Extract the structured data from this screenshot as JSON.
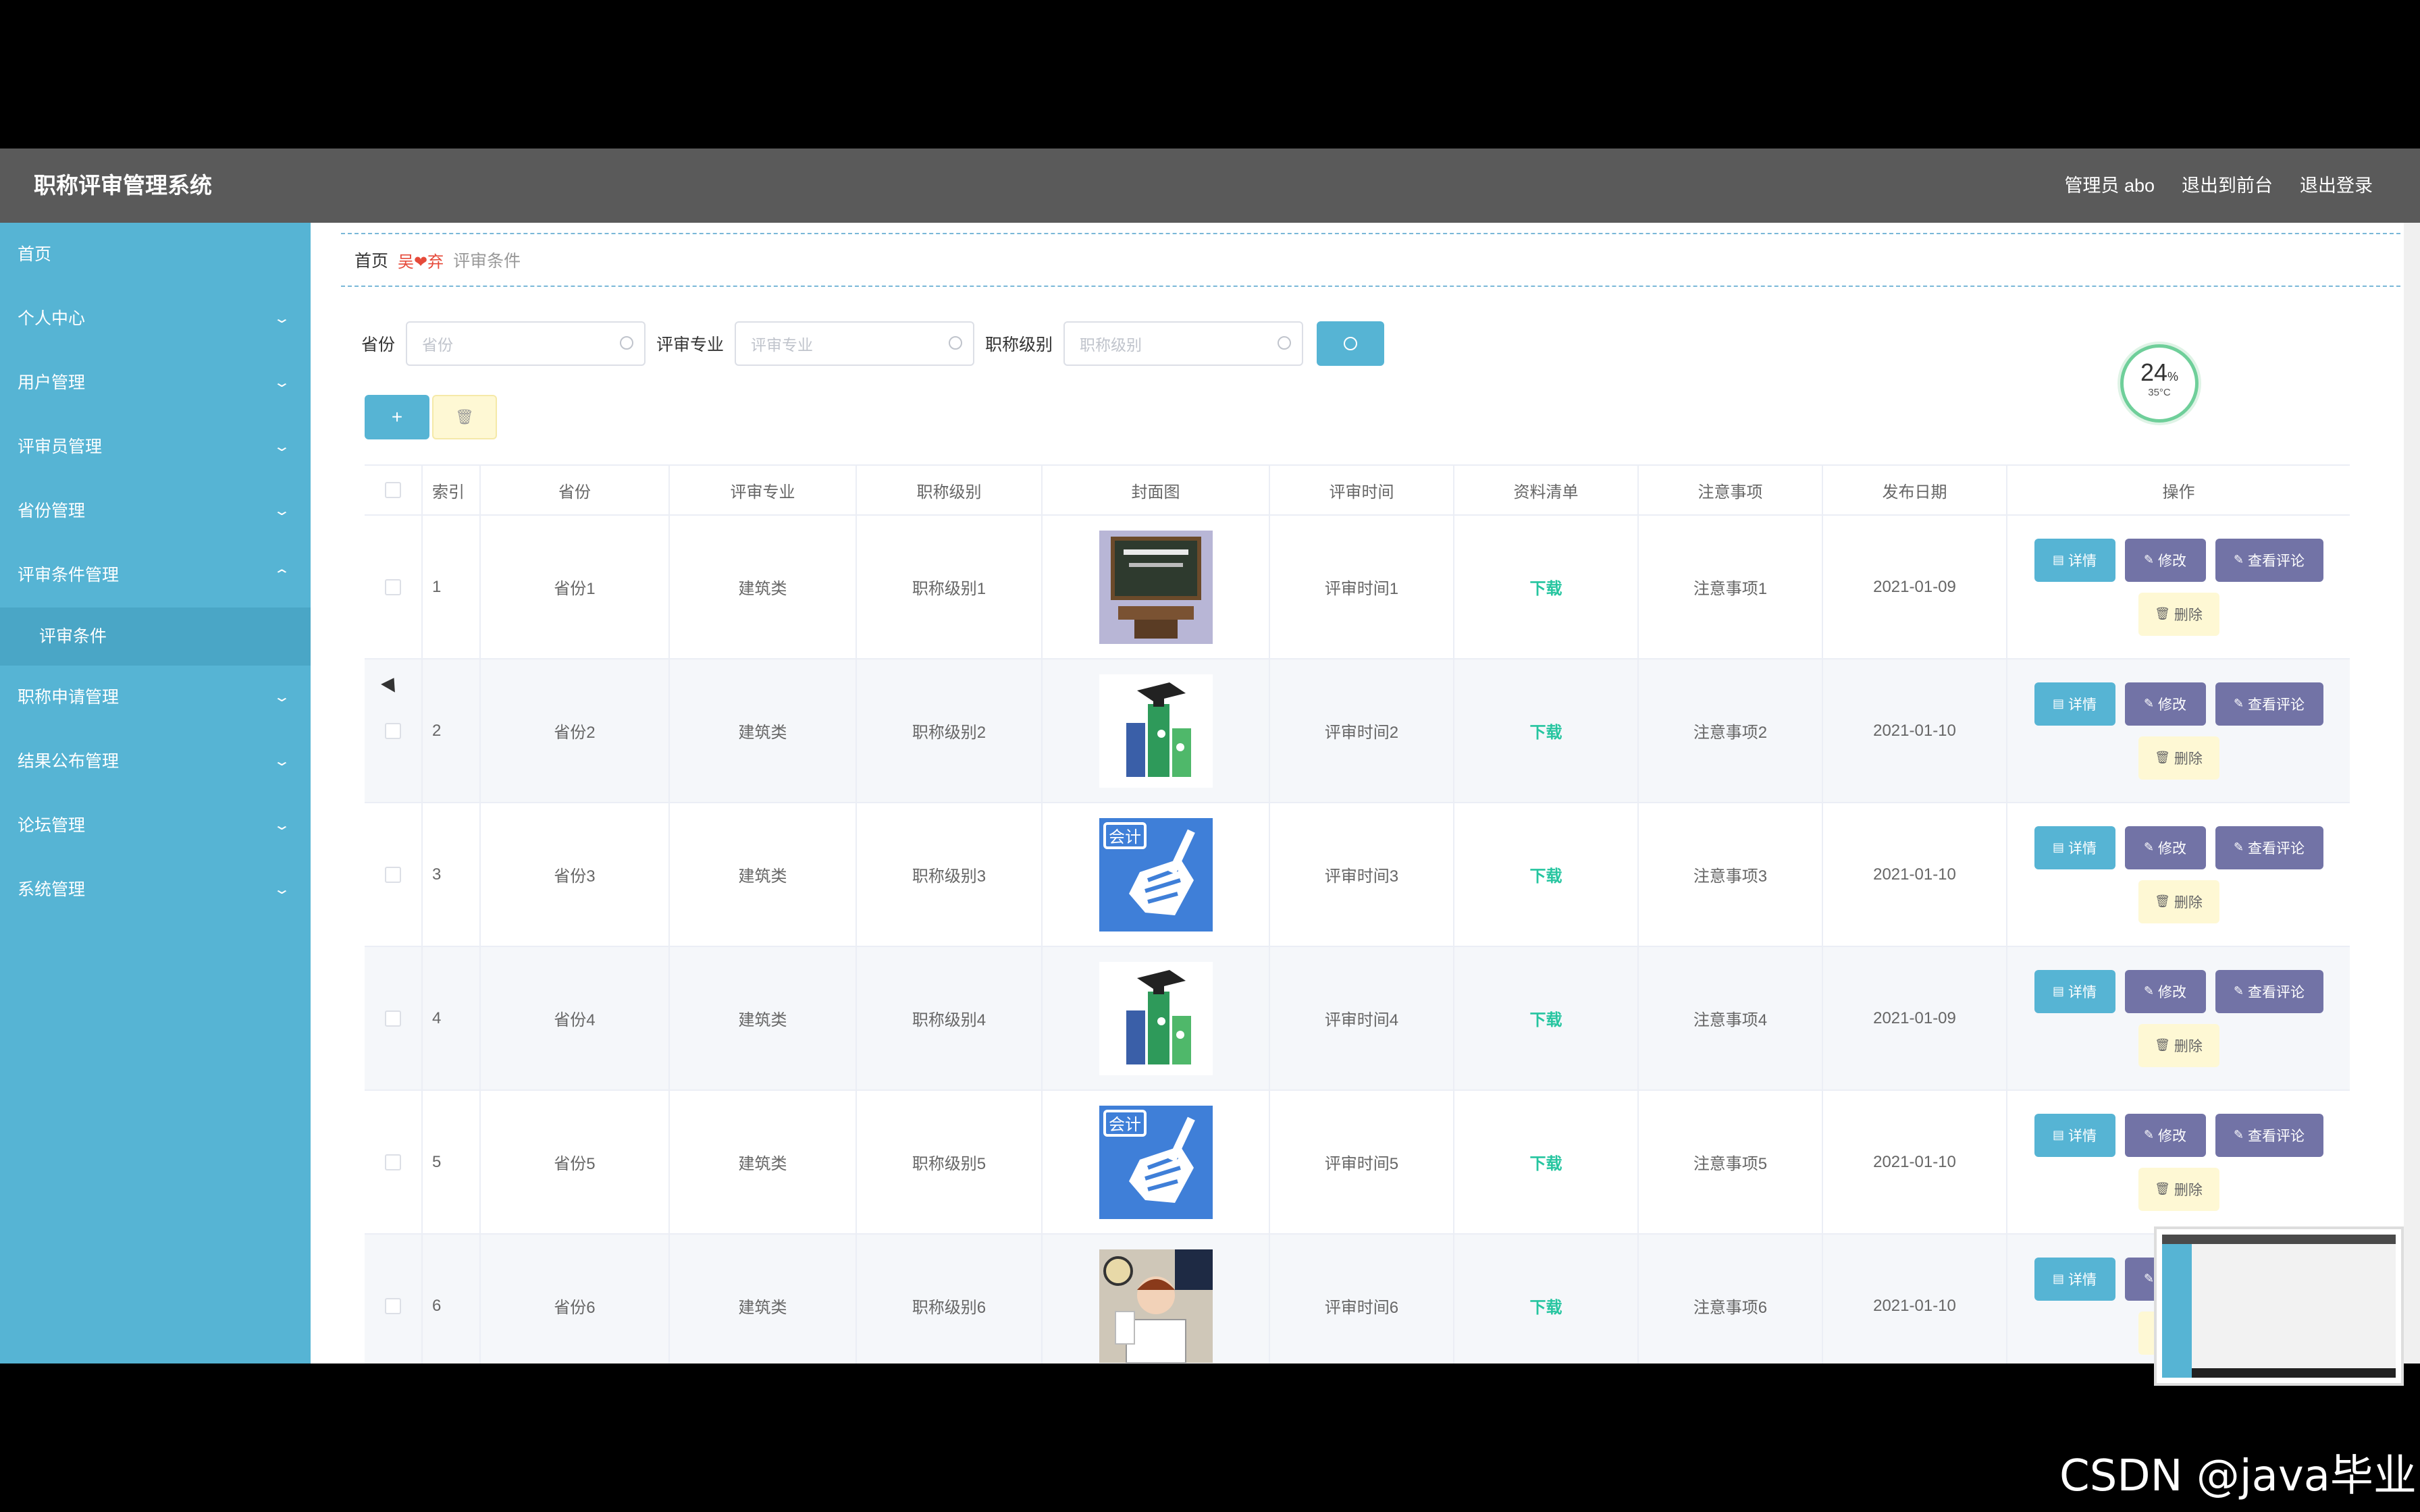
{
  "header": {
    "title": "职称评审管理系统",
    "admin": "管理员 abo",
    "back_front": "退出到前台",
    "logout": "退出登录"
  },
  "sidebar": {
    "items": [
      {
        "label": "首页"
      },
      {
        "label": "个人中心"
      },
      {
        "label": "用户管理"
      },
      {
        "label": "评审员管理"
      },
      {
        "label": "省份管理"
      },
      {
        "label": "评审条件管理"
      },
      {
        "label": "评审条件"
      },
      {
        "label": "职称申请管理"
      },
      {
        "label": "结果公布管理"
      },
      {
        "label": "论坛管理"
      },
      {
        "label": "系统管理"
      }
    ]
  },
  "breadcrumb": {
    "home": "首页",
    "sep": "吴❤弃",
    "current": "评审条件"
  },
  "search": {
    "province_label": "省份",
    "province_placeholder": "省份",
    "major_label": "评审专业",
    "major_placeholder": "评审专业",
    "level_label": "职称级别",
    "level_placeholder": "职称级别"
  },
  "toolbar": {
    "add": "+",
    "delete": "🗑"
  },
  "table": {
    "columns": [
      "索引",
      "省份",
      "评审专业",
      "职称级别",
      "封面图",
      "评审时间",
      "资料清单",
      "注意事项",
      "发布日期",
      "操作"
    ],
    "rows": [
      {
        "idx": "1",
        "province": "省份1",
        "major": "建筑类",
        "level": "职称级别1",
        "cover": "chalkboard",
        "time": "评审时间1",
        "doc": "下载",
        "note": "注意事项1",
        "date": "2021-01-09"
      },
      {
        "idx": "2",
        "province": "省份2",
        "major": "建筑类",
        "level": "职称级别2",
        "cover": "graduate-books",
        "time": "评审时间2",
        "doc": "下载",
        "note": "注意事项2",
        "date": "2021-01-10"
      },
      {
        "idx": "3",
        "province": "省份3",
        "major": "建筑类",
        "level": "职称级别3",
        "cover": "accounting-fist",
        "time": "评审时间3",
        "doc": "下载",
        "note": "注意事项3",
        "date": "2021-01-10"
      },
      {
        "idx": "4",
        "province": "省份4",
        "major": "建筑类",
        "level": "职称级别4",
        "cover": "graduate-books",
        "time": "评审时间4",
        "doc": "下载",
        "note": "注意事项4",
        "date": "2021-01-09"
      },
      {
        "idx": "5",
        "province": "省份5",
        "major": "建筑类",
        "level": "职称级别5",
        "cover": "accounting-fist",
        "time": "评审时间5",
        "doc": "下载",
        "note": "注意事项5",
        "date": "2021-01-10"
      },
      {
        "idx": "6",
        "province": "省份6",
        "major": "建筑类",
        "level": "职称级别6",
        "cover": "student-desk",
        "time": "评审时间6",
        "doc": "下载",
        "note": "注意事项6",
        "date": "2021-01-10"
      }
    ],
    "ops": {
      "detail": "详情",
      "modify": "修改",
      "review": "查看评论",
      "delete": "删除"
    }
  },
  "gauge": {
    "percent": "24",
    "unit": "%",
    "temp": "35°C"
  },
  "watermark": "CSDN @java毕业",
  "colors": {
    "sidebar": "#56b4d4",
    "header": "#5a5a5a",
    "primary": "#56b4d4",
    "purple": "#7273a6",
    "download": "#26c5a0"
  }
}
